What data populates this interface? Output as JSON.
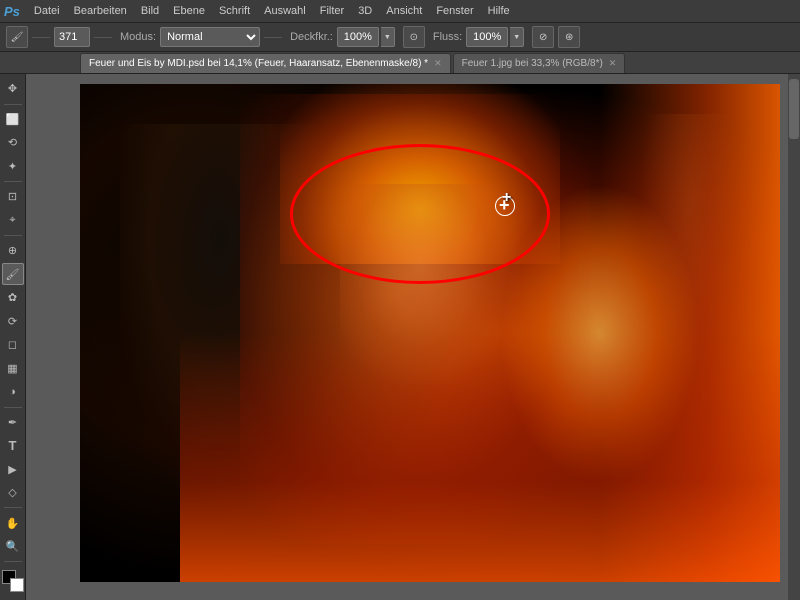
{
  "menubar": {
    "logo": "Ps",
    "items": [
      "Datei",
      "Bearbeiten",
      "Bild",
      "Ebene",
      "Schrift",
      "Auswahl",
      "Filter",
      "3D",
      "Ansicht",
      "Fenster",
      "Hilfe"
    ]
  },
  "toolbar": {
    "brush_size": "371",
    "modus_label": "Modus:",
    "modus_value": "Normal",
    "deckraft_label": "Deckfkr.:",
    "deckraft_value": "100%",
    "fluss_label": "Fluss:",
    "fluss_value": "100%"
  },
  "tabs": [
    {
      "label": "Feuer und Eis by MDI.psd bei 14,1% (Feuer, Haaransatz, Ebenenmaske/8) *",
      "active": true
    },
    {
      "label": "Feuer 1.jpg bei 33,3% (RGB/8*)",
      "active": false
    }
  ],
  "tools": [
    {
      "name": "move",
      "icon": "✥"
    },
    {
      "name": "marquee-rect",
      "icon": "⬜"
    },
    {
      "name": "marquee-ellipse",
      "icon": "⬭"
    },
    {
      "name": "lasso",
      "icon": "⟲"
    },
    {
      "name": "magic-wand",
      "icon": "✦"
    },
    {
      "name": "crop",
      "icon": "⊡"
    },
    {
      "name": "eyedropper",
      "icon": "🖋"
    },
    {
      "name": "healing-brush",
      "icon": "⊕"
    },
    {
      "name": "brush",
      "icon": "🖌"
    },
    {
      "name": "clone-stamp",
      "icon": "✿"
    },
    {
      "name": "history-brush",
      "icon": "⟳"
    },
    {
      "name": "eraser",
      "icon": "◻"
    },
    {
      "name": "gradient",
      "icon": "▦"
    },
    {
      "name": "dodge",
      "icon": "◑"
    },
    {
      "name": "pen",
      "icon": "✒"
    },
    {
      "name": "text",
      "icon": "T"
    },
    {
      "name": "path-selection",
      "icon": "▶"
    },
    {
      "name": "shape",
      "icon": "◇"
    },
    {
      "name": "hand",
      "icon": "✋"
    },
    {
      "name": "zoom",
      "icon": "🔍"
    }
  ],
  "canvas": {
    "red_oval": true,
    "cursor_visible": true
  },
  "colors": {
    "accent": "#4a9fd4",
    "bg_dark": "#3c3c3c",
    "bg_medium": "#3a3a3a",
    "tab_active": "#636363",
    "fire_primary": "#ff6600",
    "red_oval": "#ff0000"
  }
}
